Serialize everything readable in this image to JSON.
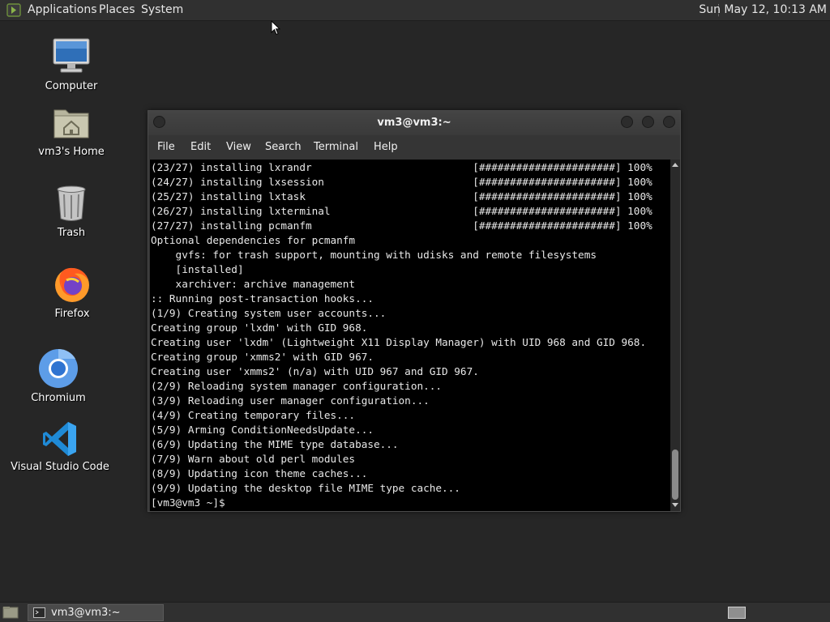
{
  "top_panel": {
    "menus": [
      "Applications",
      "Places",
      "System"
    ],
    "clock": "Sun May 12, 10:13 AM"
  },
  "desktop_icons": [
    {
      "label": "Computer",
      "icon": "computer-icon"
    },
    {
      "label": "vm3's Home",
      "icon": "home-folder-icon"
    },
    {
      "label": "Trash",
      "icon": "trash-icon"
    },
    {
      "label": "Firefox",
      "icon": "firefox-icon"
    },
    {
      "label": "Chromium",
      "icon": "chromium-icon"
    },
    {
      "label": "Visual Studio Code",
      "icon": "vscode-icon"
    }
  ],
  "terminal": {
    "title": "vm3@vm3:~",
    "menu": [
      "File",
      "Edit",
      "View",
      "Search",
      "Terminal",
      "Help"
    ],
    "lines": [
      "(23/27) installing lxrandr                          [######################] 100%",
      "(24/27) installing lxsession                        [######################] 100%",
      "(25/27) installing lxtask                           [######################] 100%",
      "(26/27) installing lxterminal                       [######################] 100%",
      "(27/27) installing pcmanfm                          [######################] 100%",
      "Optional dependencies for pcmanfm",
      "    gvfs: for trash support, mounting with udisks and remote filesystems",
      "    [installed]",
      "    xarchiver: archive management",
      ":: Running post-transaction hooks...",
      "(1/9) Creating system user accounts...",
      "Creating group 'lxdm' with GID 968.",
      "Creating user 'lxdm' (Lightweight X11 Display Manager) with UID 968 and GID 968.",
      "Creating group 'xmms2' with GID 967.",
      "Creating user 'xmms2' (n/a) with UID 967 and GID 967.",
      "(2/9) Reloading system manager configuration...",
      "(3/9) Reloading user manager configuration...",
      "(4/9) Creating temporary files...",
      "(5/9) Arming ConditionNeedsUpdate...",
      "(6/9) Updating the MIME type database...",
      "(7/9) Warn about old perl modules",
      "(8/9) Updating icon theme caches...",
      "(9/9) Updating the desktop file MIME type cache...",
      "[vm3@vm3 ~]$"
    ]
  },
  "taskbar": {
    "task_label": "vm3@vm3:~"
  },
  "colors": {
    "desktop_bg": "#262626",
    "panel_bg": "#303030",
    "terminal_bg": "#000000",
    "terminal_fg": "#e8e8e8"
  }
}
